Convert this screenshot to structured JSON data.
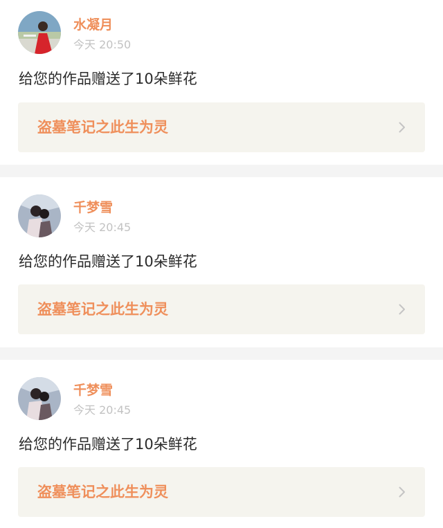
{
  "notifications": [
    {
      "user": "水凝月",
      "time": "今天 20:50",
      "message": "给您的作品赠送了10朵鲜花",
      "work_title": "盗墓笔记之此生为灵",
      "avatar_icon": "avatar-red-dress-icon"
    },
    {
      "user": "千梦雪",
      "time": "今天 20:45",
      "message": "给您的作品赠送了10朵鲜花",
      "work_title": "盗墓笔记之此生为灵",
      "avatar_icon": "avatar-couple-icon"
    },
    {
      "user": "千梦雪",
      "time": "今天 20:45",
      "message": "给您的作品赠送了10朵鲜花",
      "work_title": "盗墓笔记之此生为灵",
      "avatar_icon": "avatar-couple-icon"
    }
  ],
  "colors": {
    "accent": "#ef8f5b",
    "link_bg": "#f5f4ee",
    "divider": "#f4f4f4",
    "timestamp": "#c2c2c2",
    "text": "#2b2b2b"
  }
}
